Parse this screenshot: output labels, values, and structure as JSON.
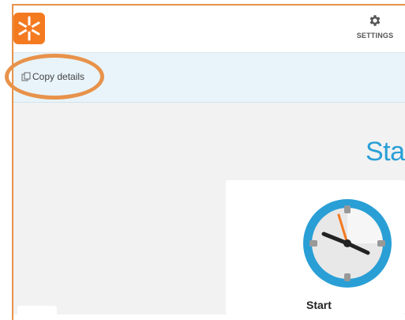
{
  "header": {
    "logo_icon": "asterisk-logo-icon",
    "settings": {
      "icon": "gear-icon",
      "label": "SETTINGS"
    }
  },
  "toolbar": {
    "copy_details": {
      "icon": "copy-icon",
      "label": "Copy details"
    }
  },
  "main": {
    "hero_title": "Star",
    "card": {
      "icon": "clock-icon",
      "label": "Start"
    }
  },
  "colors": {
    "brand_orange": "#f47a20",
    "highlight": "#e8924a",
    "toolbar_bg": "#e8f4fa",
    "accent_blue": "#2a9fd6",
    "content_bg": "#f2f2f2"
  }
}
